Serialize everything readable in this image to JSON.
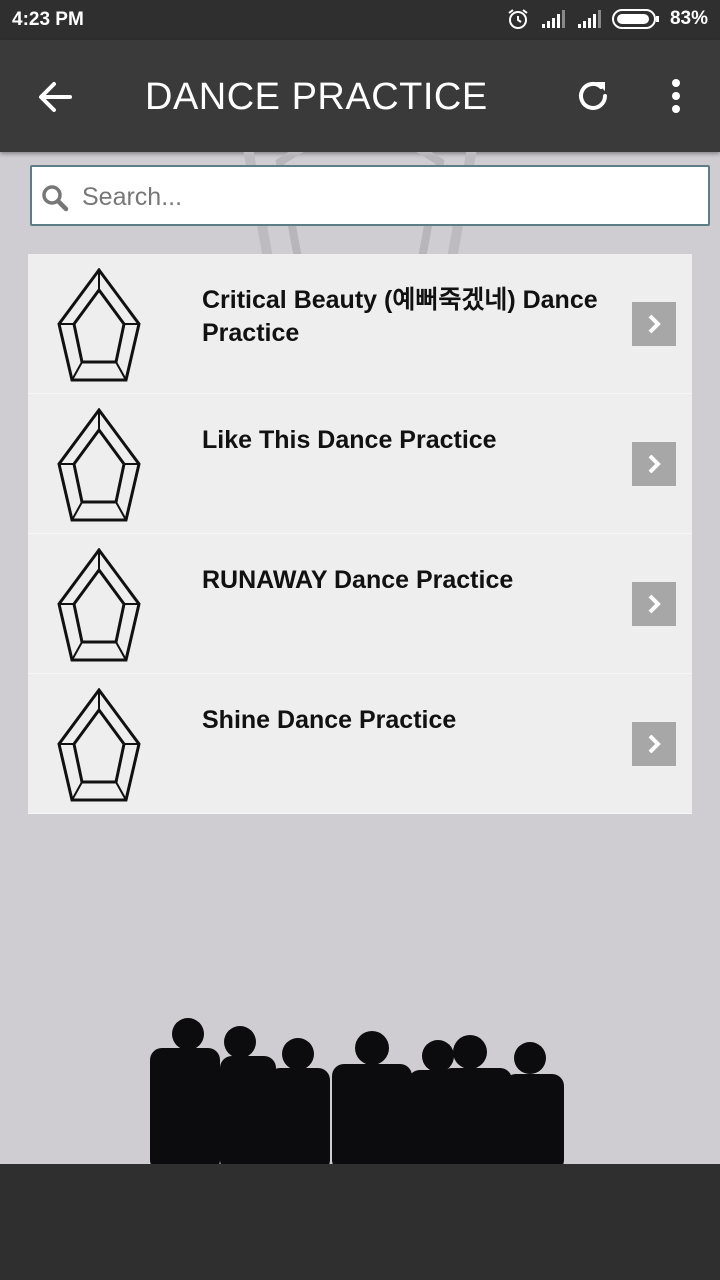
{
  "status_bar": {
    "time": "4:23 PM",
    "battery_percent": "83%",
    "icons": [
      "alarm-icon",
      "signal-icon",
      "signal-icon",
      "battery-icon"
    ]
  },
  "app_bar": {
    "title": "DANCE PRACTICE",
    "back_icon": "arrow-left-icon",
    "refresh_icon": "refresh-icon",
    "menu_icon": "more-vertical-icon"
  },
  "search": {
    "placeholder": "Search...",
    "value": ""
  },
  "videos": [
    {
      "title": "Critical Beauty (예뻐죽겠네) Dance Practice",
      "icon": "pentagon-logo-icon"
    },
    {
      "title": "Like This Dance Practice",
      "icon": "pentagon-logo-icon"
    },
    {
      "title": "RUNAWAY Dance Practice",
      "icon": "pentagon-logo-icon"
    },
    {
      "title": "Shine Dance Practice",
      "icon": "pentagon-logo-icon"
    }
  ],
  "colors": {
    "status_bar": "#2f2f2f",
    "app_bar": "#3a3a3a",
    "background": "#cfcdd1",
    "list_bg": "#eeeeee",
    "arrow_bg": "#a7a7a7",
    "search_border": "#5e7e86"
  }
}
